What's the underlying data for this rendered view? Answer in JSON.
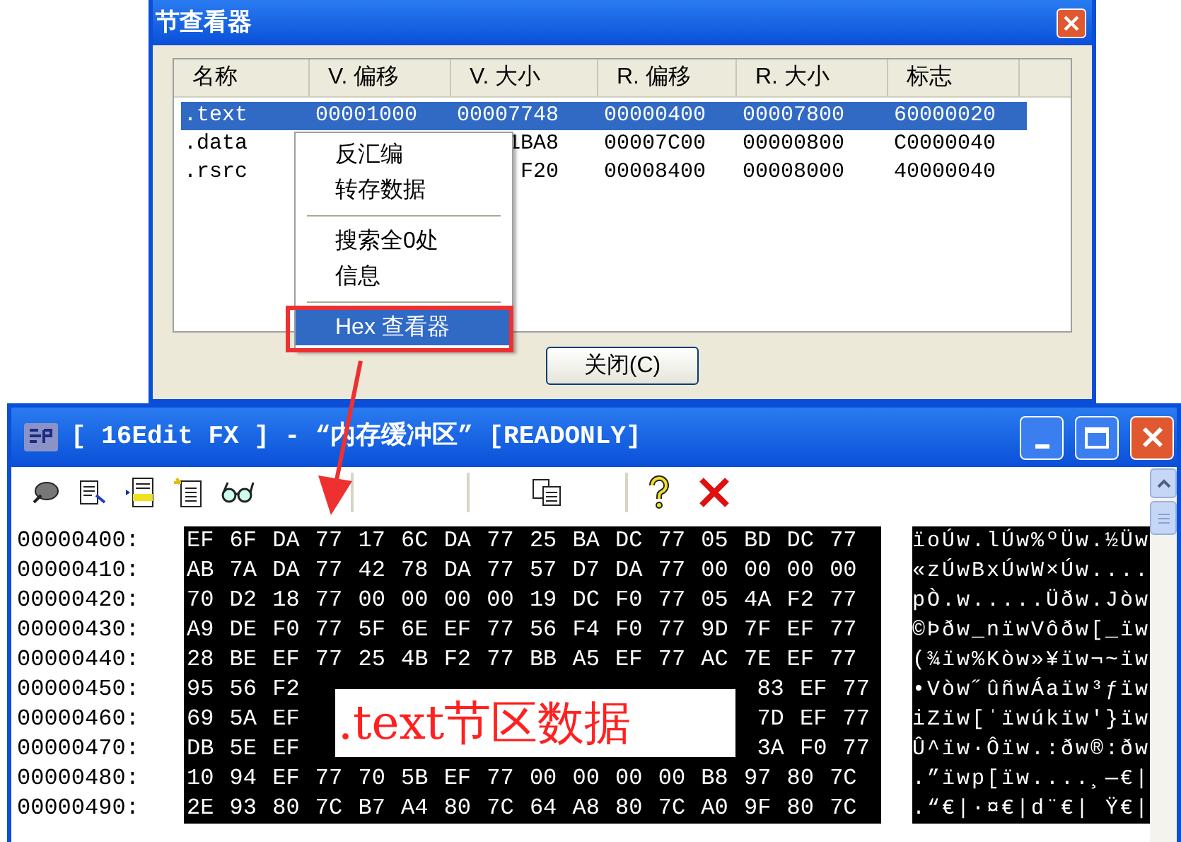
{
  "section_viewer": {
    "title": "节查看器",
    "columns": [
      "名称",
      "V. 偏移",
      "V. 大小",
      "R. 偏移",
      "R. 大小",
      "标志"
    ],
    "rows": [
      {
        "selected": true,
        "cells": [
          ".text",
          "00001000",
          "00007748",
          "00000400",
          "00007800",
          "60000020"
        ]
      },
      {
        "selected": false,
        "cells": [
          ".data",
          null,
          "1BA8",
          "00007C00",
          "00000800",
          "C0000040"
        ]
      },
      {
        "selected": false,
        "cells": [
          ".rsrc",
          null,
          "F20",
          "00008400",
          "00008000",
          "40000040"
        ]
      }
    ],
    "context_menu": [
      {
        "kind": "item",
        "label": "反汇编",
        "selected": false
      },
      {
        "kind": "item",
        "label": "转存数据",
        "selected": false
      },
      {
        "kind": "separator"
      },
      {
        "kind": "item",
        "label": "搜索全0处",
        "selected": false
      },
      {
        "kind": "item",
        "label": "信息",
        "selected": false
      },
      {
        "kind": "separator"
      },
      {
        "kind": "item",
        "label": "Hex 查看器",
        "selected": true
      }
    ],
    "close_button": "关闭(C)"
  },
  "annotation_label": ".text节区数据",
  "hex_editor": {
    "title": "[ 16Edit FX ] - “内存缓冲区” [READONLY]",
    "rows": [
      {
        "address": "00000400:",
        "hex": [
          "EF 6F DA 77 17 6C DA 77 25 BA DC 77 05 BD DC 77"
        ],
        "text": "ïoÚw.lÚw%ºÜw.½Üw"
      },
      {
        "address": "00000410:",
        "hex": [
          "AB 7A DA 77 42 78 DA 77 57 D7 DA 77 00 00 00 00"
        ],
        "text": "«zÚwBxÚwW×Úw...."
      },
      {
        "address": "00000420:",
        "hex": [
          "70 D2 18 77 00 00 00 00 19 DC F0 77 05 4A F2 77"
        ],
        "text": "pÒ.w.....Üðw.Jòw"
      },
      {
        "address": "00000430:",
        "hex": [
          "A9 DE F0 77 5F 6E EF 77 56 F4 F0 77 9D 7F EF 77"
        ],
        "text": "©Þðw_nïwVôðw[_ïw"
      },
      {
        "address": "00000440:",
        "hex": [
          "28 BE EF 77 25 4B F2 77 BB A5 EF 77 AC 7E EF 77"
        ],
        "text": "(¾ïw%Kòw»¥ïw¬~ïw"
      },
      {
        "address": "00000450:",
        "hex": [
          "95 56 F2",
          "83 EF 77"
        ],
        "text": "•Vòw˝ûñwÁaïw³ƒïw"
      },
      {
        "address": "00000460:",
        "hex": [
          "69 5A EF",
          "7D EF 77"
        ],
        "text": "iZïw[ˈïwúkïw'}ïw"
      },
      {
        "address": "00000470:",
        "hex": [
          "DB 5E EF",
          "3A F0 77"
        ],
        "text": "Û^ïw·Ôïw.:ðw®:ðw"
      },
      {
        "address": "00000480:",
        "hex": [
          "10 94 EF 77 70 5B EF 77 00 00 00 00 B8 97 80 7C"
        ],
        "text": ".”ïwp[ïw....¸—€|"
      },
      {
        "address": "00000490:",
        "hex": [
          "2E 93 80 7C B7 A4 80 7C 64 A8 80 7C A0 9F 80 7C"
        ],
        "text": ".“€|·¤€|d¨€| Ÿ€|"
      }
    ]
  }
}
